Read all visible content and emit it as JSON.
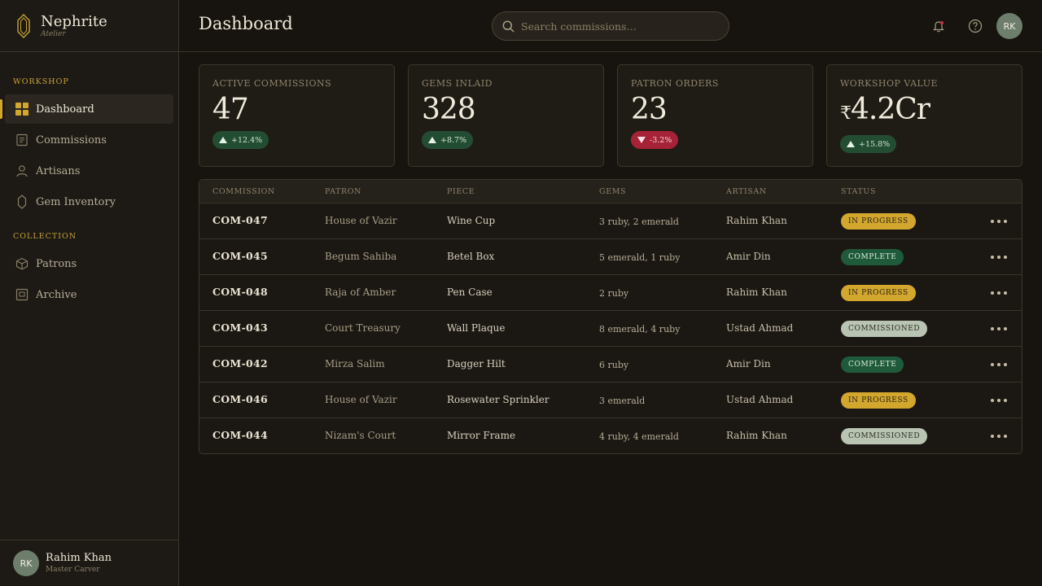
{
  "brand": {
    "name": "Nephrite",
    "sub": "Atelier"
  },
  "sidebar": {
    "sections": [
      {
        "label": "WORKSHOP"
      },
      {
        "label": "COLLECTION"
      }
    ],
    "items": [
      {
        "label": "Dashboard",
        "icon": "grid-icon",
        "active": true
      },
      {
        "label": "Commissions",
        "icon": "document-icon"
      },
      {
        "label": "Artisans",
        "icon": "person-icon"
      },
      {
        "label": "Gem Inventory",
        "icon": "gem-icon"
      },
      {
        "label": "Patrons",
        "icon": "box-icon"
      },
      {
        "label": "Archive",
        "icon": "archive-icon"
      }
    ]
  },
  "user": {
    "initials": "RK",
    "name": "Rahim Khan",
    "role": "Master Carver"
  },
  "header": {
    "title": "Dashboard",
    "search_placeholder": "Search commissions…",
    "avatar_initials": "RK"
  },
  "cards": [
    {
      "label": "Active Commissions",
      "value": "47",
      "trend": "+12.4%",
      "direction": "up"
    },
    {
      "label": "Gems Inlaid",
      "value": "328",
      "trend": "+8.7%",
      "direction": "up"
    },
    {
      "label": "Patron Orders",
      "value": "23",
      "trend": "-3.2%",
      "direction": "down"
    },
    {
      "label": "Workshop Value",
      "currency": "₹",
      "value": "4.2Cr",
      "trend": "+15.8%",
      "direction": "up"
    }
  ],
  "table": {
    "headers": [
      "Commission",
      "Patron",
      "Piece",
      "Gems",
      "Artisan",
      "Status"
    ],
    "rows": [
      {
        "id": "COM-047",
        "patron": "House of Vazir",
        "piece": "Wine Cup",
        "gems": "3 ruby, 2 emerald",
        "artisan": "Rahim Khan",
        "status": "In Progress",
        "kind": "progress"
      },
      {
        "id": "COM-045",
        "patron": "Begum Sahiba",
        "piece": "Betel Box",
        "gems": "5 emerald, 1 ruby",
        "artisan": "Amir Din",
        "status": "Complete",
        "kind": "complete"
      },
      {
        "id": "COM-048",
        "patron": "Raja of Amber",
        "piece": "Pen Case",
        "gems": "2 ruby",
        "artisan": "Rahim Khan",
        "status": "In Progress",
        "kind": "progress"
      },
      {
        "id": "COM-043",
        "patron": "Court Treasury",
        "piece": "Wall Plaque",
        "gems": "8 emerald, 4 ruby",
        "artisan": "Ustad Ahmad",
        "status": "Commissioned",
        "kind": "commissioned"
      },
      {
        "id": "COM-042",
        "patron": "Mirza Salim",
        "piece": "Dagger Hilt",
        "gems": "6 ruby",
        "artisan": "Amir Din",
        "status": "Complete",
        "kind": "complete"
      },
      {
        "id": "COM-046",
        "patron": "House of Vazir",
        "piece": "Rosewater Sprinkler",
        "gems": "3 emerald",
        "artisan": "Ustad Ahmad",
        "status": "In Progress",
        "kind": "progress"
      },
      {
        "id": "COM-044",
        "patron": "Nizam's Court",
        "piece": "Mirror Frame",
        "gems": "4 ruby, 4 emerald",
        "artisan": "Rahim Khan",
        "status": "Commissioned",
        "kind": "commissioned"
      }
    ]
  },
  "colors": {
    "accent": "#d3a72e",
    "up": "#234d33",
    "down": "#a62236"
  }
}
